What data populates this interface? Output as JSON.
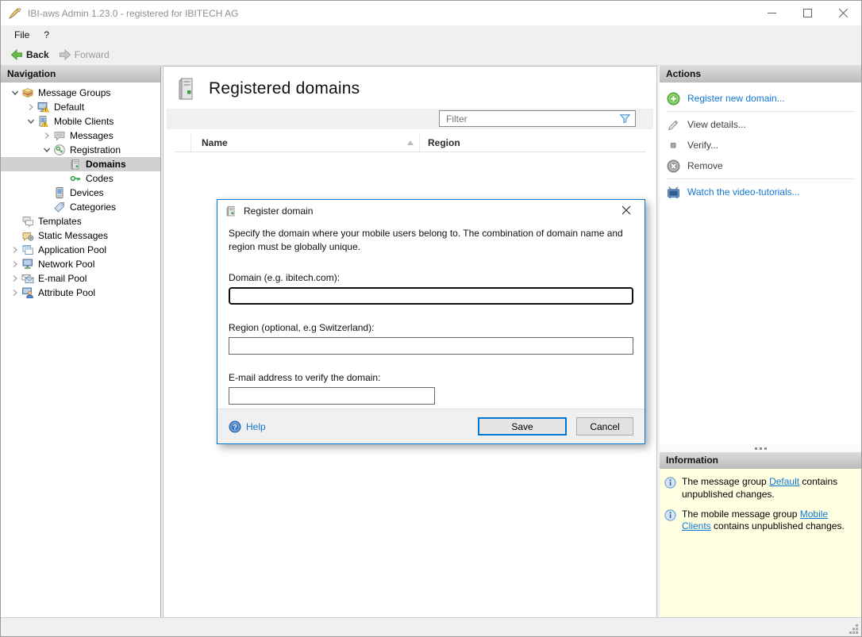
{
  "colors": {
    "accent": "#0078d7",
    "link_blue": "#1177d1",
    "info_panel_bg": "#ffffe1",
    "selection_gray": "#d1d1d1",
    "action_green": "#6abf4b"
  },
  "window": {
    "title": "IBI-aws Admin 1.23.0 - registered for IBITECH AG"
  },
  "menu": {
    "items": [
      {
        "label": "File"
      },
      {
        "label": "?"
      }
    ]
  },
  "toolbar": {
    "back": "Back",
    "forward": "Forward"
  },
  "nav": {
    "header": "Navigation",
    "items": [
      {
        "label": "Message Groups",
        "level": 0,
        "expanded": true
      },
      {
        "label": "Default",
        "level": 1,
        "expanded": false
      },
      {
        "label": "Mobile Clients",
        "level": 1,
        "expanded": true
      },
      {
        "label": "Messages",
        "level": 2,
        "expanded": false
      },
      {
        "label": "Registration",
        "level": 2,
        "expanded": true
      },
      {
        "label": "Domains",
        "level": 3,
        "selected": true
      },
      {
        "label": "Codes",
        "level": 3
      },
      {
        "label": "Devices",
        "level": 2
      },
      {
        "label": "Categories",
        "level": 2
      },
      {
        "label": "Templates",
        "level": 0
      },
      {
        "label": "Static Messages",
        "level": 0
      },
      {
        "label": "Application Pool",
        "level": 0,
        "expanded": false
      },
      {
        "label": "Network Pool",
        "level": 0,
        "expanded": false
      },
      {
        "label": "E-mail Pool",
        "level": 0,
        "expanded": false
      },
      {
        "label": "Attribute Pool",
        "level": 0,
        "expanded": false
      }
    ]
  },
  "content": {
    "title": "Registered domains",
    "filter_placeholder": "Filter",
    "table": {
      "columns": [
        "Name",
        "Region"
      ],
      "rows": []
    }
  },
  "actions": {
    "header": "Actions",
    "items": [
      {
        "label": "Register new domain...",
        "enabled": true
      },
      {
        "label": "View details...",
        "enabled": false
      },
      {
        "label": "Verify...",
        "enabled": false
      },
      {
        "label": "Remove",
        "enabled": false
      },
      {
        "label": "Watch the video-tutorials...",
        "enabled": true
      }
    ]
  },
  "information": {
    "header": "Information",
    "items": [
      {
        "prefix": "The message group ",
        "link": "Default",
        "suffix": " contains unpublished changes."
      },
      {
        "prefix": "The mobile message group ",
        "link": "Mobile Clients",
        "suffix": " contains unpublished changes."
      }
    ]
  },
  "dialog": {
    "title": "Register domain",
    "description": "Specify the domain where your mobile users belong to. The combination of domain name and region must be globally unique.",
    "domain_label": "Domain (e.g. ibitech.com):",
    "domain_value": "",
    "region_label": "Region (optional, e.g Switzerland):",
    "region_value": "",
    "email_label": "E-mail  address to verify the domain:",
    "email_value": "",
    "help_label": "Help",
    "save_label": "Save",
    "cancel_label": "Cancel"
  }
}
